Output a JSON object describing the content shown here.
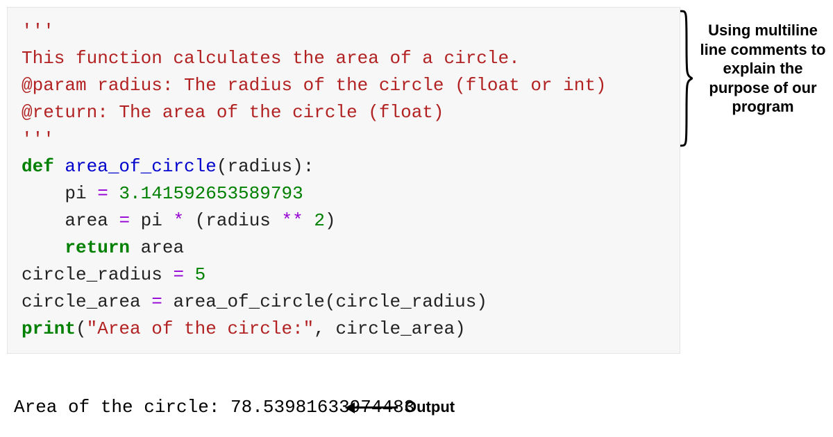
{
  "code": {
    "doc_open": "'''",
    "doc_blank1": "",
    "doc_line1": "This function calculates the area of a circle.",
    "doc_line2": "@param radius: The radius of the circle (float or int)",
    "doc_line3": "@return: The area of the circle (float)",
    "doc_blank2": "",
    "doc_close": "'''",
    "kw_def": "def",
    "fn_name": "area_of_circle",
    "paren_open": "(",
    "param": "radius",
    "paren_close_colon": "):",
    "pi_ident": "    pi ",
    "op_eq1": "=",
    "pi_val": " 3.141592653589793",
    "area_ident": "    area ",
    "op_eq2": "=",
    "pi_mul_open": " pi ",
    "op_star": "*",
    "space_open": " (radius ",
    "op_pow": "**",
    "sp_two": " ",
    "num_two": "2",
    "close_paren": ")",
    "kw_return": "    return",
    "return_tail": " area",
    "blank": "",
    "cr_assign": "circle_radius ",
    "op_eq3": "=",
    "cr_val_sp": " ",
    "cr_val": "5",
    "ca_assign": "circle_area ",
    "op_eq4": "=",
    "ca_call_pre": " area_of_circle(circle_radius)",
    "print_kw": "print",
    "print_open": "(",
    "print_str": "\"Area of the circle:\"",
    "print_rest": ", circle_area)"
  },
  "output": {
    "text": "Area of the circle: 78.53981633974483"
  },
  "annotation": {
    "comment_label": "Using multiline line comments to explain the purpose of our program",
    "output_label": "Output"
  },
  "colors": {
    "code_bg": "#f7f7f7",
    "docstring": "#b22222",
    "keyword": "#008000",
    "funcname": "#0000cd",
    "operator": "#9400d3"
  }
}
